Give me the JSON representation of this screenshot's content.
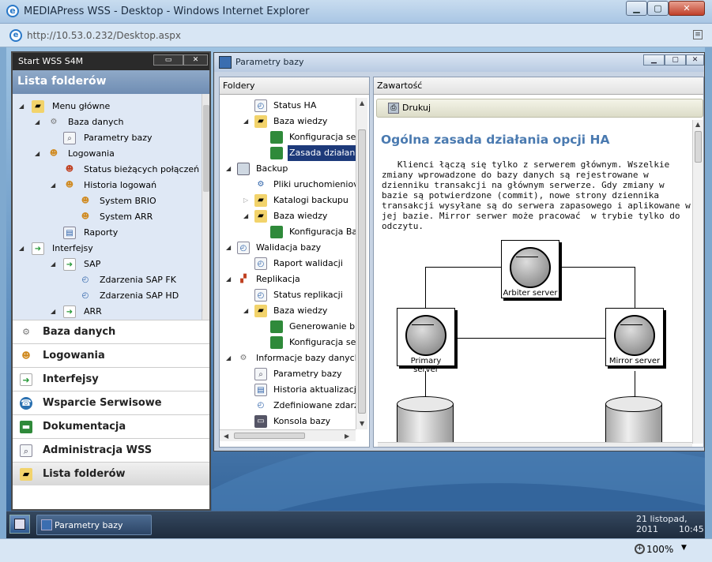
{
  "browser": {
    "title": "MEDIAPress WSS - Desktop - Windows Internet Explorer",
    "url": "http://10.53.0.232/Desktop.aspx",
    "zoom": "100%",
    "window_buttons": {
      "minimize": "▁",
      "maximize": "▢",
      "close": "✕"
    }
  },
  "left_panel": {
    "title": "Start WSS S4M",
    "header": "Lista folderów",
    "tree": [
      {
        "label": "Menu główne",
        "icon": "folder-icon"
      },
      {
        "label": "Baza danych",
        "icon": "gear-icon"
      },
      {
        "label": "Parametry bazy",
        "icon": "settings-icon"
      },
      {
        "label": "Logowania",
        "icon": "users-icon"
      },
      {
        "label": "Status bieżących połączeń",
        "icon": "user-icon"
      },
      {
        "label": "Historia logowań",
        "icon": "users-icon"
      },
      {
        "label": "System BRIO",
        "icon": "users-icon"
      },
      {
        "label": "System ARR",
        "icon": "users-icon"
      },
      {
        "label": "Raporty",
        "icon": "report-icon"
      },
      {
        "label": "Interfejsy",
        "icon": "arrow-icon"
      },
      {
        "label": "SAP",
        "icon": "arrow-icon"
      },
      {
        "label": "Zdarzenia SAP FK",
        "icon": "clock-icon"
      },
      {
        "label": "Zdarzenia SAP HD",
        "icon": "clock-icon"
      },
      {
        "label": "ARR",
        "icon": "arrow-icon"
      }
    ],
    "nav": [
      {
        "label": "Baza danych",
        "icon": "gear-icon"
      },
      {
        "label": "Logowania",
        "icon": "users-icon"
      },
      {
        "label": "Interfejsy",
        "icon": "arrow-icon"
      },
      {
        "label": "Wsparcie Serwisowe",
        "icon": "support-icon"
      },
      {
        "label": "Dokumentacja",
        "icon": "book-icon"
      },
      {
        "label": "Administracja WSS",
        "icon": "settings-icon"
      },
      {
        "label": "Lista folderów",
        "icon": "folder-icon"
      }
    ]
  },
  "main_window": {
    "title": "Parametry bazy",
    "folders_header": "Foldery",
    "content_header": "Zawartość",
    "print_label": "Drukuj",
    "folder_tree": [
      {
        "label": "Status HA",
        "icon": "doc-icon"
      },
      {
        "label": "Baza wiedzy",
        "icon": "folder-icon"
      },
      {
        "label": "Konfiguracja se",
        "icon": "book-icon"
      },
      {
        "label": "Zasada działani",
        "icon": "book-icon",
        "selected": true
      },
      {
        "label": "Backup",
        "icon": "backup-icon"
      },
      {
        "label": "Pliki uruchomieniov",
        "icon": "gear-icon"
      },
      {
        "label": "Katalogi backupu",
        "icon": "folder-icon"
      },
      {
        "label": "Baza wiedzy",
        "icon": "folder-icon"
      },
      {
        "label": "Konfiguracja Ba",
        "icon": "book-icon"
      },
      {
        "label": "Walidacja bazy",
        "icon": "doc-icon"
      },
      {
        "label": "Raport walidacji",
        "icon": "doc-icon"
      },
      {
        "label": "Replikacja",
        "icon": "replication-icon"
      },
      {
        "label": "Status replikacji",
        "icon": "doc-icon"
      },
      {
        "label": "Baza wiedzy",
        "icon": "folder-icon"
      },
      {
        "label": "Generowanie b",
        "icon": "book-icon"
      },
      {
        "label": "Konfiguracja se",
        "icon": "book-icon"
      },
      {
        "label": "Informacje bazy danych",
        "icon": "gear-icon"
      },
      {
        "label": "Parametry bazy",
        "icon": "settings-icon"
      },
      {
        "label": "Historia aktualizacji",
        "icon": "doc-icon"
      },
      {
        "label": "Zdefiniowane zdarz",
        "icon": "clock-icon"
      },
      {
        "label": "Konsola bazy",
        "icon": "console-icon"
      }
    ],
    "document": {
      "heading": "Ogólna zasada działania opcji HA",
      "paragraph": "   Klienci łączą się tylko z serwerem głównym. Wszelkie zmiany wprowadzone do bazy danych są rejestrowane w dzienniku transakcji na głównym serwerze. Gdy zmiany w bazie są potwierdzone (commit), nowe strony dziennika transakcji wysyłane są do serwera zapasowego i aplikowane w jej bazie. Mirror serwer może pracować  w trybie tylko do odczytu.",
      "diagram": {
        "arbiter": "Arbiter server",
        "primary": "Primary server",
        "mirror": "Mirror server"
      }
    }
  },
  "taskbar": {
    "window_label": "Parametry bazy",
    "date": "21 listopad, 2011",
    "time": "10:45"
  }
}
